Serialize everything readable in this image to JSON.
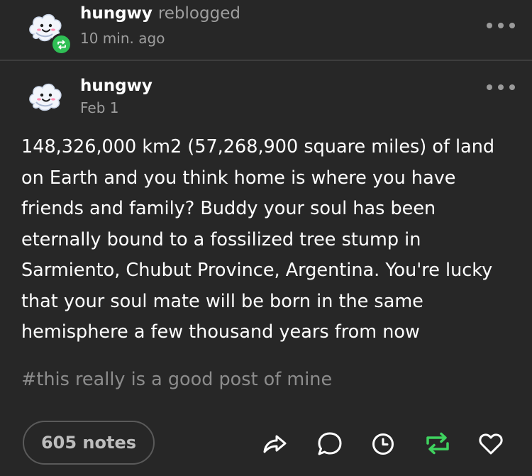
{
  "reblog": {
    "username": "hungwy",
    "action": "reblogged",
    "time": "10 min. ago",
    "avatar_icon": "cloud-face-avatar",
    "badge_icon": "reblog-icon",
    "badge_color": "#2fbf55"
  },
  "post": {
    "username": "hungwy",
    "date": "Feb 1",
    "avatar_icon": "cloud-face-avatar",
    "body": "148,326,000 km2 (57,268,900 square miles) of land on Earth and you think home is where you have friends and family? Buddy your soul has been eternally bound to a fossilized tree stump in Sarmiento, Chubut Province, Argentina. You're lucky that your soul mate will be born in the same hemisphere a few thousand years from now",
    "tags": "#this really is a good post of mine"
  },
  "footer": {
    "notes_label": "605 notes",
    "actions": [
      {
        "name": "share",
        "icon": "share-arrow-icon"
      },
      {
        "name": "reply",
        "icon": "reply-bubble-icon"
      },
      {
        "name": "queue",
        "icon": "clock-icon"
      },
      {
        "name": "reblog",
        "icon": "reblog-icon",
        "color": "#3fd35f"
      },
      {
        "name": "like",
        "icon": "heart-icon"
      }
    ]
  },
  "colors": {
    "background": "#272727",
    "text": "#ffffff",
    "muted": "#9e9e9e",
    "reblog_green": "#3fd35f"
  }
}
